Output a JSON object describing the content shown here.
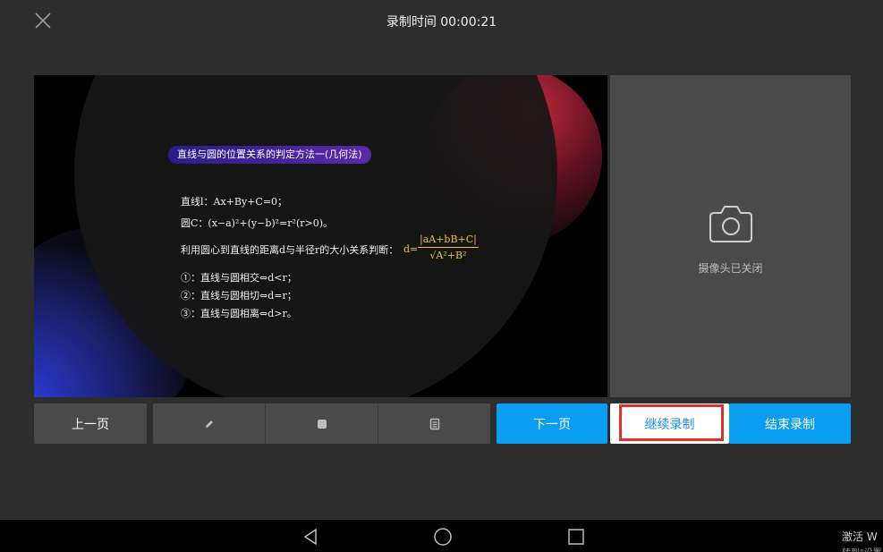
{
  "header": {
    "recording_time": "录制时间 00:00:21"
  },
  "slide": {
    "title": "直线与圆的位置关系的判定方法一(几何法)",
    "lines": [
      "直线l：Ax+By+C=0；",
      "圆C：(x−a)²+(y−b)²=r²(r>0)。",
      "利用圆心到直线的距离d与半径r的大小关系判断：",
      "①：直线与圆相交⇔d<r；",
      "②：直线与圆相切⇔d=r；",
      "③：直线与圆相离⇔d>r。"
    ],
    "formula_lhs": "d=",
    "formula_numerator": "|aA+bB+C|",
    "formula_denominator": "√A²+B²"
  },
  "camera": {
    "status": "摄像头已关闭",
    "icon": "camera-icon"
  },
  "controls": {
    "prev_label": "上一页",
    "tools": [
      "pen-icon",
      "square-icon",
      "document-icon"
    ],
    "next_label": "下一页",
    "continue_label": "继续录制",
    "end_label": "结束录制",
    "accent_color": "#0a9ef3",
    "highlight_color": "#e0302a"
  },
  "system": {
    "nav": [
      "back-icon",
      "home-icon",
      "recents-icon"
    ],
    "watermark": "激活 W",
    "watermark_line2": "转到\"设置"
  }
}
